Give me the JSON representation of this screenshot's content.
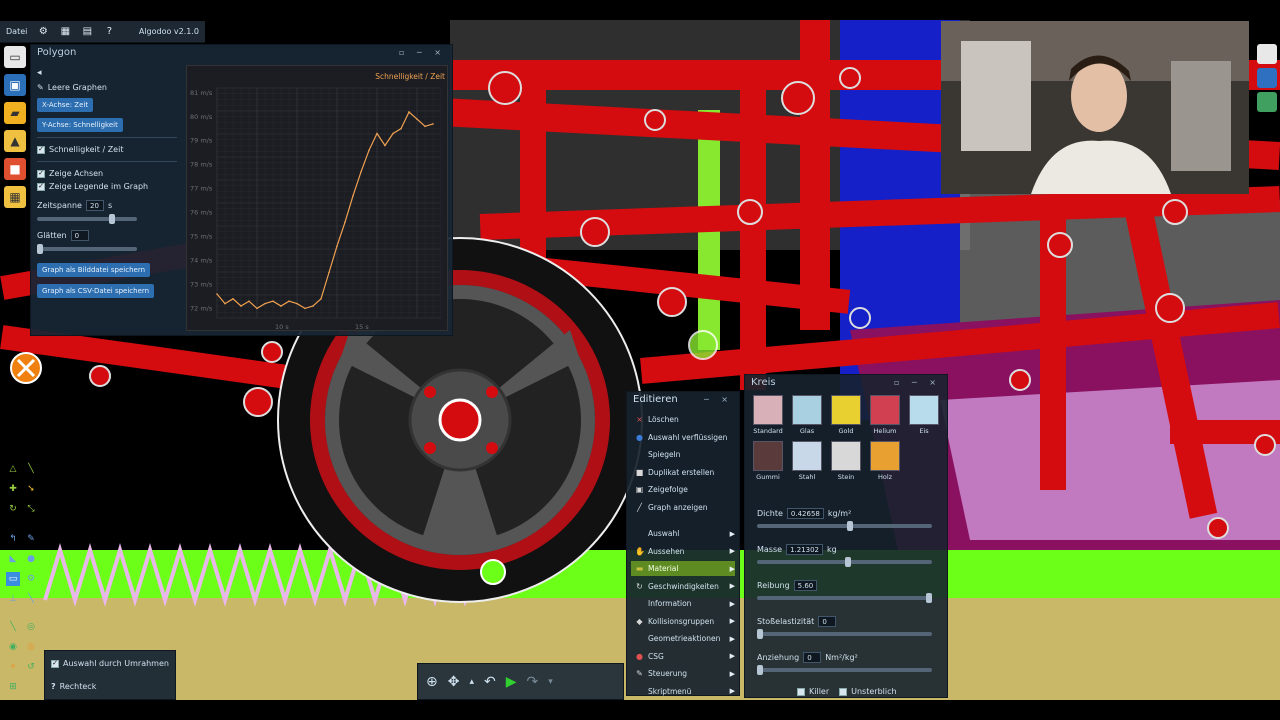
{
  "topbar": {
    "menu_label": "Datei",
    "version": "Algodoo v2.1.0"
  },
  "polygon_panel": {
    "title": "Polygon",
    "clear_graphs": "Leere Graphen",
    "x_axis_button": "X-Achse: Zeit",
    "y_axis_button": "Y-Achse: Schnelligkeit",
    "speed_time_label": "Schnelligkeit / Zeit",
    "show_axes": "Zeige Achsen",
    "show_legend": "Zeige Legende im Graph",
    "timespan_label": "Zeitspanne",
    "timespan_value": "20",
    "timespan_unit": "s",
    "smoothing_label": "Glätten",
    "smoothing_value": "0",
    "save_image_button": "Graph als Bilddatei speichern",
    "save_csv_button": "Graph als CSV-Datei speichern"
  },
  "graph": {
    "legend": "Schnelligkeit / Zeit",
    "y_ticks": [
      "81 m/s",
      "80 m/s",
      "79 m/s",
      "78 m/s",
      "77 m/s",
      "76 m/s",
      "75 m/s",
      "74 m/s",
      "73 m/s",
      "72 m/s"
    ],
    "x_ticks": [
      "10 s",
      "15 s"
    ]
  },
  "chart_data": {
    "type": "line",
    "title": "",
    "xlabel": "",
    "ylabel": "",
    "legend": "Schnelligkeit / Zeit",
    "ylim": [
      71.6,
      81.2
    ],
    "xlim": [
      6,
      20
    ],
    "series": [
      {
        "name": "Schnelligkeit / Zeit",
        "color": "#f0a050",
        "x": [
          6.0,
          6.5,
          7.0,
          7.5,
          8.0,
          8.5,
          9.0,
          9.5,
          10.0,
          10.5,
          11.0,
          11.5,
          12.0,
          12.5,
          13.0,
          13.5,
          14.0,
          14.5,
          15.0,
          15.5,
          16.0,
          16.5,
          17.0,
          17.5,
          18.0,
          18.5,
          19.0,
          19.5
        ],
        "y": [
          72.6,
          72.2,
          72.4,
          72.1,
          72.3,
          72.0,
          72.2,
          72.3,
          72.1,
          72.3,
          72.2,
          72.0,
          72.1,
          72.4,
          73.5,
          74.6,
          75.6,
          76.7,
          77.7,
          78.6,
          79.3,
          78.8,
          79.3,
          79.5,
          80.2,
          79.9,
          79.6,
          79.7
        ]
      }
    ]
  },
  "context_menu": {
    "title": "Editieren",
    "items": [
      {
        "label": "Löschen",
        "icon": "×",
        "icon_color": "#e05050"
      },
      {
        "label": "Auswahl verflüssigen",
        "icon": "●",
        "icon_color": "#3b7bd8"
      },
      {
        "label": "Spiegeln",
        "icon": "",
        "icon_color": "#cfe0ee"
      },
      {
        "label": "Duplikat erstellen",
        "icon": "■",
        "icon_color": "#d8d8d8"
      },
      {
        "label": "Zeigefolge",
        "icon": "▣",
        "icon_color": "#d8d8d8"
      },
      {
        "label": "Graph anzeigen",
        "icon": "╱",
        "icon_color": "#d8d8d8"
      },
      {
        "label": "Auswahl",
        "icon": "",
        "icon_color": "#cfe0ee",
        "sub": true
      },
      {
        "label": "Aussehen",
        "icon": "✋",
        "icon_color": "#d99a4a",
        "sub": true
      },
      {
        "label": "Material",
        "icon": "▬",
        "icon_color": "#c8c040",
        "sub": true,
        "selected": true
      },
      {
        "label": "Geschwindigkeiten",
        "icon": "↻",
        "icon_color": "#d8d8d8",
        "sub": true
      },
      {
        "label": "Information",
        "icon": "",
        "icon_color": "#cfe0ee",
        "sub": true
      },
      {
        "label": "Kollisionsgruppen",
        "icon": "◆",
        "icon_color": "#d8d8d8",
        "sub": true
      },
      {
        "label": "Geometrieaktionen",
        "icon": "",
        "icon_color": "#cfe0ee",
        "sub": true
      },
      {
        "label": "CSG",
        "icon": "●",
        "icon_color": "#e05050",
        "sub": true
      },
      {
        "label": "Steuerung",
        "icon": "✎",
        "icon_color": "#d8d8d8",
        "sub": true
      },
      {
        "label": "Skriptmenü",
        "icon": "",
        "icon_color": "#cfe0ee",
        "sub": true
      }
    ]
  },
  "kreis_panel": {
    "title": "Kreis",
    "materials": [
      {
        "label": "Standard",
        "color": "#d8b0b8"
      },
      {
        "label": "Glas",
        "color": "#a8d0e0"
      },
      {
        "label": "Gold",
        "color": "#e8d030"
      },
      {
        "label": "Helium",
        "color": "#d04050"
      },
      {
        "label": "Eis",
        "color": "#b8dcec"
      },
      {
        "label": "Gummi",
        "color": "#5a3a3a"
      },
      {
        "label": "Stahl",
        "color": "#c8d8e8"
      },
      {
        "label": "Stein",
        "color": "#d8d8d8"
      },
      {
        "label": "Holz",
        "color": "#e8a030"
      }
    ],
    "density_label": "Dichte",
    "density_value": "0.42658",
    "density_unit": "kg/m²",
    "mass_label": "Masse",
    "mass_value": "1.21302",
    "mass_unit": "kg",
    "friction_label": "Reibung",
    "friction_value": "5.60",
    "restitution_label": "Stoßelastizität",
    "restitution_value": "0",
    "attraction_label": "Anziehung",
    "attraction_value": "0",
    "attraction_unit": "Nm²/kg²",
    "check_killer": "Killer",
    "check_invisible": "Unsterblich"
  },
  "selection_options": {
    "rect_select": "Auswahl durch Umrahmen",
    "rect_label": "Rechteck"
  }
}
